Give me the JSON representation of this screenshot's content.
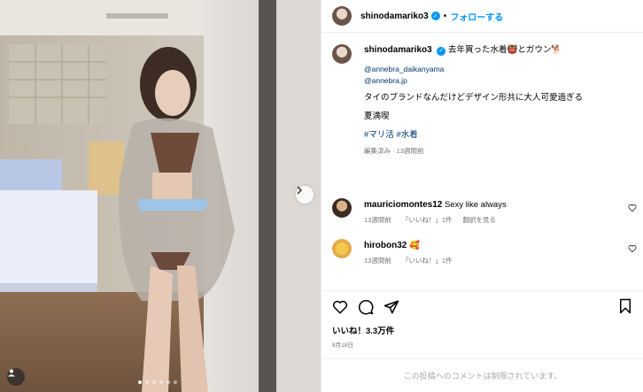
{
  "post": {
    "username": "shinodamariko3",
    "follow_label": "フォローする",
    "separator": "•"
  },
  "caption": {
    "username": "shinodamariko3",
    "text": "去年買った水着",
    "text_end": "とガウン",
    "mention1": "@annebra_daikanyama",
    "mention2": "@annebra.jp",
    "body": "タイのブランドなんだけどデザイン形共に大人可愛過ぎる",
    "signature": "夏満喫",
    "hashtags": "#マリ活 #水着",
    "meta": "編集済み · 13週間前"
  },
  "comments": [
    {
      "username": "mauriciomontes12",
      "text": "Sexy like always",
      "time": "13週間前",
      "likes": "「いいね！」1件",
      "reply": "翻訳を見る"
    },
    {
      "username": "hirobon32",
      "text": "🥰",
      "time": "13週間前",
      "likes": "「いいね！」1件"
    }
  ],
  "likes": "いいね！3.3万件",
  "date": "8月18日",
  "comments_limited": "この投稿へのコメントは制限されています。",
  "carousel": {
    "count": 6,
    "active": 0
  },
  "colors": {
    "accent": "#0095f6",
    "link": "#00376b",
    "muted": "#737373"
  }
}
